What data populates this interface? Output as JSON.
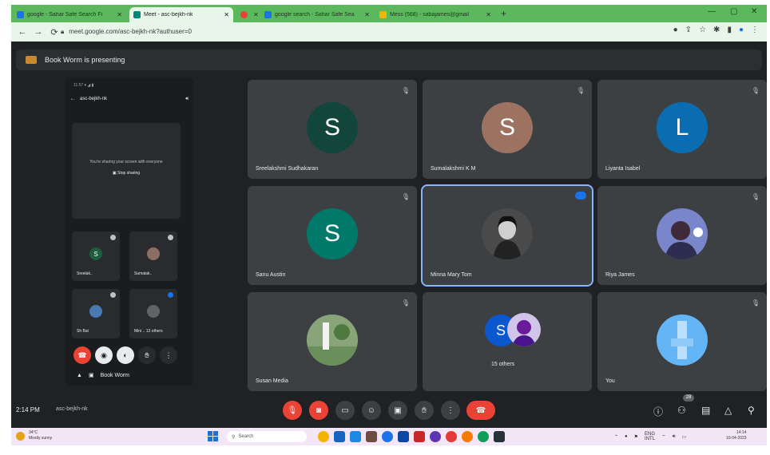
{
  "browser": {
    "tabs": [
      {
        "label": "google - Sahar Safe Search Fi",
        "favicon_color": "#1a73e8",
        "active": false
      },
      {
        "label": "Meet - asc-bejkh-nk",
        "favicon_color": "#00897b",
        "active": true
      },
      {
        "label": "",
        "favicon_color": "#ea4335",
        "active": false
      },
      {
        "label": "google search - Sahar Safe Sea",
        "favicon_color": "#1a73e8",
        "active": false
      },
      {
        "label": "Mess (568) - sabajames@gmail",
        "favicon_color": "#f4b400",
        "active": false
      }
    ],
    "url": "meet.google.com/asc-bejkh-nk?authuser=0"
  },
  "presenting_banner": "Book Worm is presenting",
  "presentation": {
    "status_bar": "11:57 ▾ ◢ ▮",
    "meeting_code": "asc-bejkh-nk",
    "sharing_message": "You're sharing your screen with everyone",
    "stop_sharing_label": "Stop sharing",
    "mini_tiles": [
      {
        "initial": "S",
        "name": "Sreelak..",
        "color": "#1e5e3c"
      },
      {
        "initial": "",
        "name": "Sumalak..",
        "color": "#8d6e63"
      },
      {
        "initial": "",
        "name": "Sh Bal",
        "color": "#4a78b0"
      },
      {
        "initial": "",
        "name": "Mini  .. 13 others",
        "color": "#5f6368"
      }
    ],
    "presenter_name": "Book Worm"
  },
  "participants": [
    {
      "name": "Sreelakshmi Sudhakaran",
      "initial": "S",
      "color": "#12463b",
      "type": "initial"
    },
    {
      "name": "Sumalakshmi K M",
      "initial": "S",
      "color": "#9c7260",
      "type": "initial"
    },
    {
      "name": "Liyanta Isabel",
      "initial": "L",
      "color": "#0b6db1",
      "type": "initial"
    },
    {
      "name": "Sanu Austin",
      "initial": "S",
      "color": "#00796b",
      "type": "initial"
    },
    {
      "name": "Minna Mary Tom",
      "initial": "",
      "color": "#5f6368",
      "type": "photo",
      "speaking": true
    },
    {
      "name": "Riya James",
      "initial": "",
      "color": "#8c9eff",
      "type": "photo"
    },
    {
      "name": "Susan Media",
      "initial": "",
      "color": "#6b8f5a",
      "type": "photo"
    },
    {
      "name": "15 others",
      "initial": "S",
      "color": "#0b57d0",
      "type": "group"
    },
    {
      "name": "You",
      "initial": "",
      "color": "#90caf9",
      "type": "photo"
    }
  ],
  "bottom_bar": {
    "time": "2:14 PM",
    "meeting_code": "asc-bejkh-nk",
    "people_count": "28"
  },
  "taskbar": {
    "weather_temp": "34°C",
    "weather_desc": "Mostly sunny",
    "search_placeholder": "Search",
    "lang": "ENG\nINTL",
    "clock_time": "14:14",
    "clock_date": "10-04-2023"
  },
  "icons": {
    "back": "back-arrow-icon",
    "forward": "forward-arrow-icon",
    "reload": "reload-icon",
    "mic_off": "mic-off-icon",
    "cam_off": "camera-off-icon",
    "captions": "captions-icon",
    "emoji": "emoji-icon",
    "present": "present-icon",
    "hand": "raise-hand-icon",
    "more": "more-options-icon",
    "end_call": "end-call-icon",
    "info": "info-icon",
    "people": "people-icon",
    "chat": "chat-icon",
    "activities": "activities-icon",
    "host": "host-controls-icon"
  }
}
